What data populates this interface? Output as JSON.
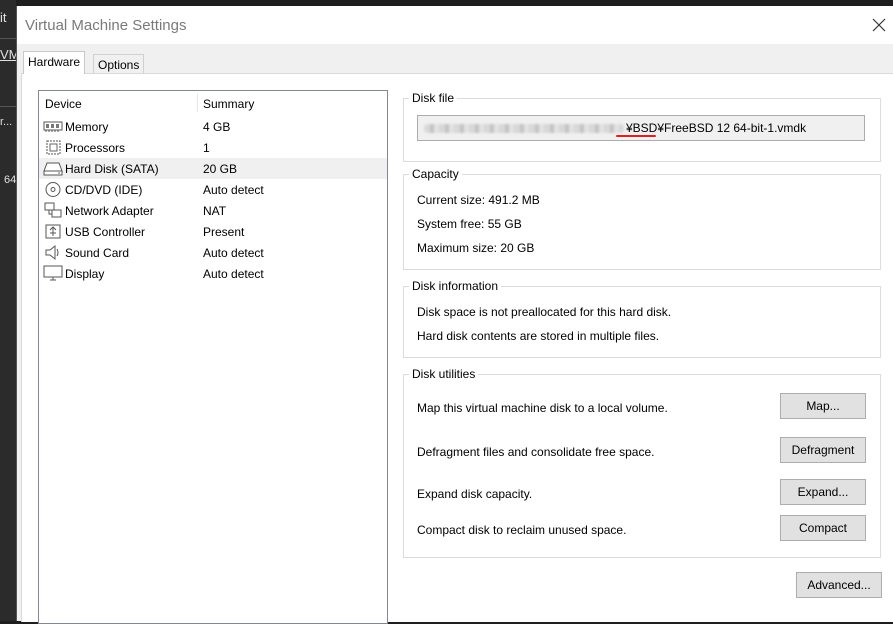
{
  "background_app": {
    "fragment_1": "it",
    "fragment_2": "VM",
    "fragment_3": "r...",
    "fragment_4": "64"
  },
  "window": {
    "title": "Virtual Machine Settings"
  },
  "tabs": [
    {
      "label": "Hardware",
      "active": true
    },
    {
      "label": "Options",
      "active": false
    }
  ],
  "device_list": {
    "columns": [
      "Device",
      "Summary"
    ],
    "rows": [
      {
        "name": "Memory",
        "summary": "4 GB",
        "icon": "memory-icon"
      },
      {
        "name": "Processors",
        "summary": "1",
        "icon": "processor-icon"
      },
      {
        "name": "Hard Disk (SATA)",
        "summary": "20 GB",
        "icon": "hard-disk-icon",
        "selected": true
      },
      {
        "name": "CD/DVD (IDE)",
        "summary": "Auto detect",
        "icon": "cd-dvd-icon"
      },
      {
        "name": "Network Adapter",
        "summary": "NAT",
        "icon": "network-icon"
      },
      {
        "name": "USB Controller",
        "summary": "Present",
        "icon": "usb-icon"
      },
      {
        "name": "Sound Card",
        "summary": "Auto detect",
        "icon": "speaker-icon"
      },
      {
        "name": "Display",
        "summary": "Auto detect",
        "icon": "monitor-icon"
      }
    ]
  },
  "disk_file": {
    "legend": "Disk file",
    "path_visible": "¥BSD¥FreeBSD 12 64-bit-1.vmdk"
  },
  "capacity": {
    "legend": "Capacity",
    "current": "Current size: 491.2 MB",
    "system_free": "System free: 55 GB",
    "maximum": "Maximum size: 20 GB"
  },
  "disk_information": {
    "legend": "Disk information",
    "line1": "Disk space is not preallocated for this hard disk.",
    "line2": "Hard disk contents are stored in multiple files."
  },
  "disk_utilities": {
    "legend": "Disk utilities",
    "items": [
      {
        "text": "Map this virtual machine disk to a local volume.",
        "button": "Map..."
      },
      {
        "text": "Defragment files and consolidate free space.",
        "button": "Defragment"
      },
      {
        "text": "Expand disk capacity.",
        "button": "Expand..."
      },
      {
        "text": "Compact disk to reclaim unused space.",
        "button": "Compact"
      }
    ]
  },
  "advanced_button": "Advanced...",
  "colors": {
    "accent_underline": "#e02020",
    "selected_row": "#f0f0f0"
  }
}
